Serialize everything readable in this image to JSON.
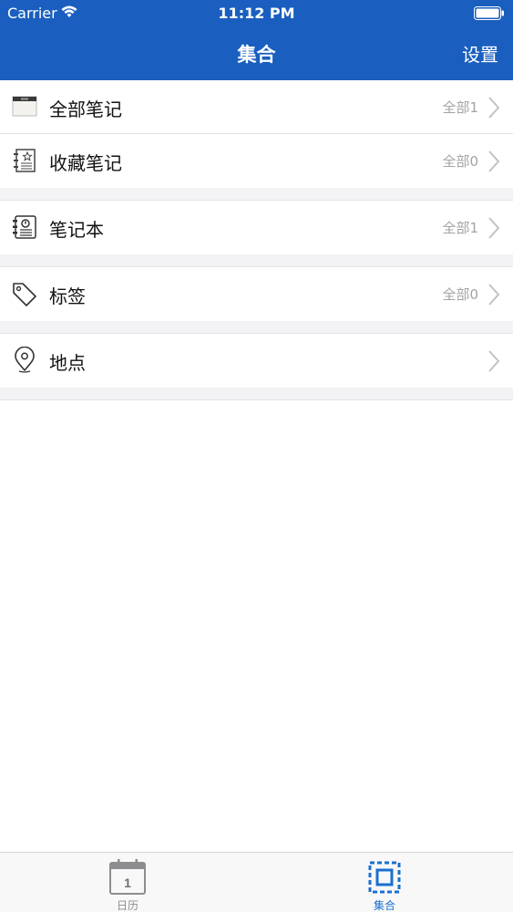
{
  "status_bar": {
    "carrier": "Carrier",
    "time": "11:12 PM"
  },
  "nav": {
    "title": "集合",
    "right_button": "设置"
  },
  "sections": [
    {
      "rows": [
        {
          "label": "全部笔记",
          "count": "全部1",
          "icon": "all-notes-icon"
        },
        {
          "label": "收藏笔记",
          "count": "全部0",
          "icon": "favorite-notes-icon"
        }
      ]
    },
    {
      "rows": [
        {
          "label": "笔记本",
          "count": "全部1",
          "icon": "notebook-icon"
        }
      ]
    },
    {
      "rows": [
        {
          "label": "标签",
          "count": "全部0",
          "icon": "tag-icon"
        }
      ]
    },
    {
      "rows": [
        {
          "label": "地点",
          "count": "",
          "icon": "location-pin-icon"
        }
      ]
    }
  ],
  "tabbar": {
    "tabs": [
      {
        "label": "日历",
        "icon": "calendar-icon",
        "badge_text": "1",
        "selected": false
      },
      {
        "label": "集合",
        "icon": "collection-icon",
        "selected": true
      }
    ]
  },
  "colors": {
    "nav_blue": "#1a5fbf",
    "tab_active": "#1a70d0",
    "tab_inactive": "#8d8d90"
  }
}
